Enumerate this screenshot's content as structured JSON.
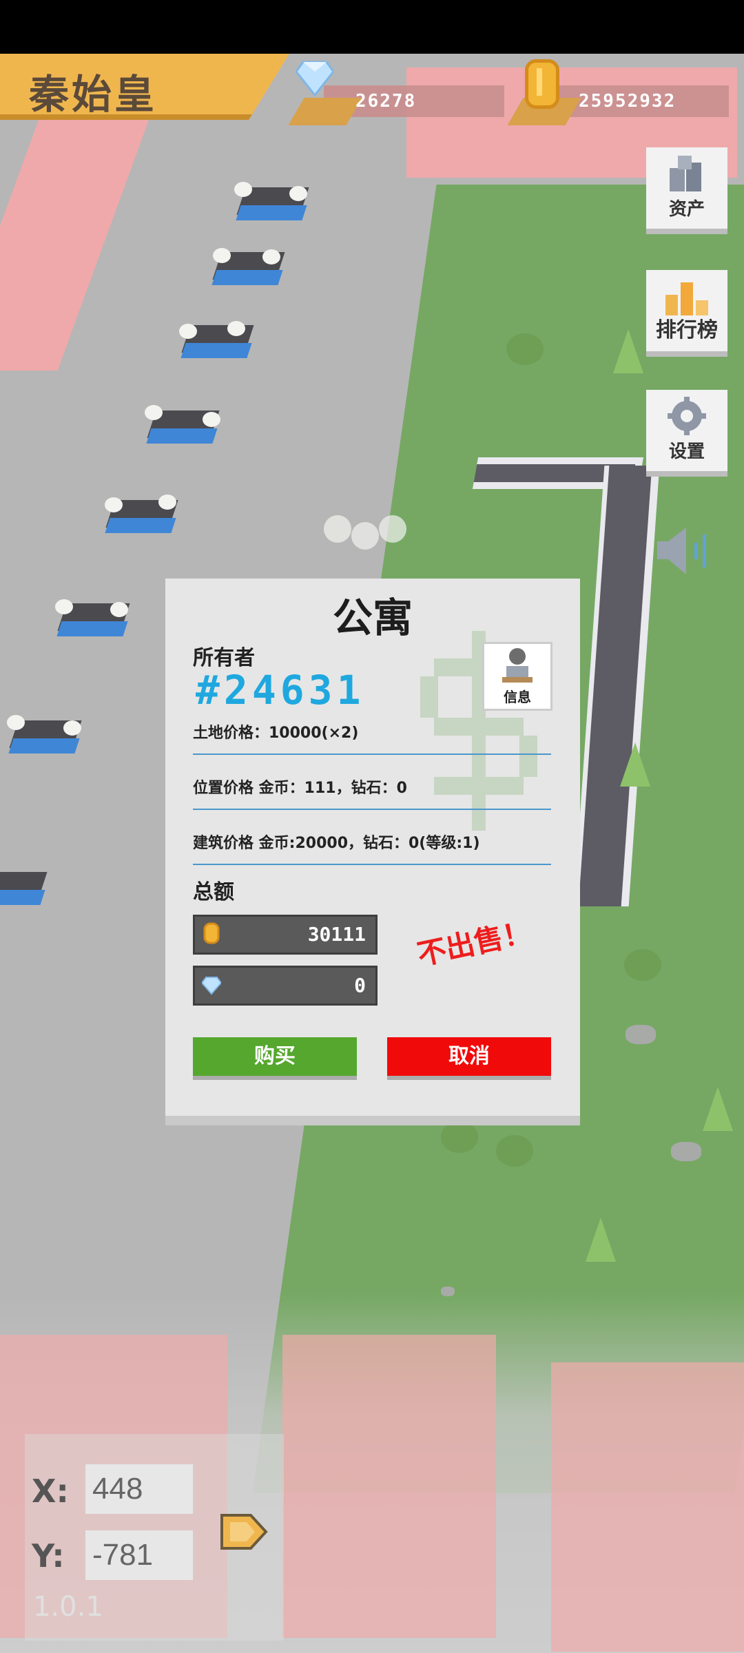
{
  "header": {
    "player_name": "秦始皇",
    "diamonds": "26278",
    "coins": "25952932"
  },
  "side_buttons": [
    {
      "label": "资产",
      "icon": "assets-icon"
    },
    {
      "label": "排行榜",
      "icon": "leaderboard-icon"
    },
    {
      "label": "设置",
      "icon": "settings-icon"
    },
    {
      "label": "",
      "icon": "sound-icon"
    }
  ],
  "dialog": {
    "title": "公寓",
    "owner_label": "所有者",
    "owner_id": "#24631",
    "info_label": "信息",
    "land_price": "土地价格：10000(×2)",
    "location_price": "位置价格 金币：111，钻石：0",
    "building_price": "建筑价格 金币:20000，钻石：0(等级:1)",
    "total_label": "总额",
    "total_coins": "30111",
    "total_diamonds": "0",
    "not_for_sale": "不出售！",
    "buy_label": "购买",
    "cancel_label": "取消"
  },
  "coordinates": {
    "x_label": "X:",
    "y_label": "Y:",
    "x_value": "448",
    "y_value": "-781",
    "version": "1.0.1"
  },
  "colors": {
    "banner": "#f0b64e",
    "owner_id": "#1fa8df",
    "buy": "#55a72e",
    "cancel": "#f00a0a",
    "not_for_sale": "#ee1d1d"
  }
}
